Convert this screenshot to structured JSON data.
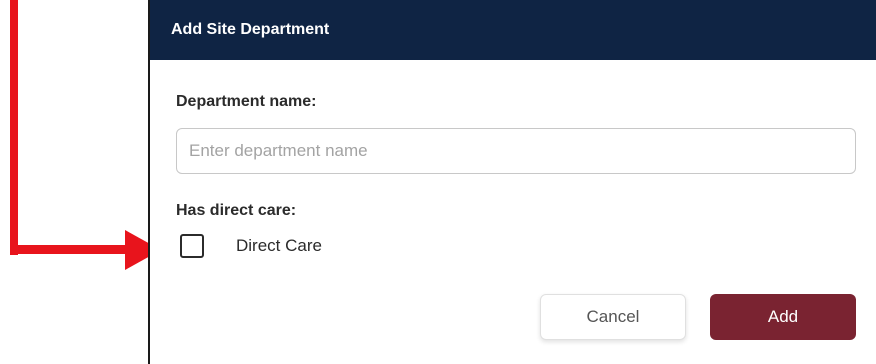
{
  "dialog": {
    "title": "Add Site Department",
    "department_label": "Department name:",
    "department_placeholder": "Enter department name",
    "department_value": "",
    "direct_care_label": "Has direct care:",
    "checkbox_label": "Direct Care",
    "checkbox_checked": false,
    "cancel_label": "Cancel",
    "add_label": "Add"
  },
  "colors": {
    "header_bg": "#0f2444",
    "add_button_bg": "#7a2331",
    "annotation_arrow": "#e8141c"
  },
  "annotations": {
    "arrow_icon": "red-arrow-pointing-right"
  }
}
